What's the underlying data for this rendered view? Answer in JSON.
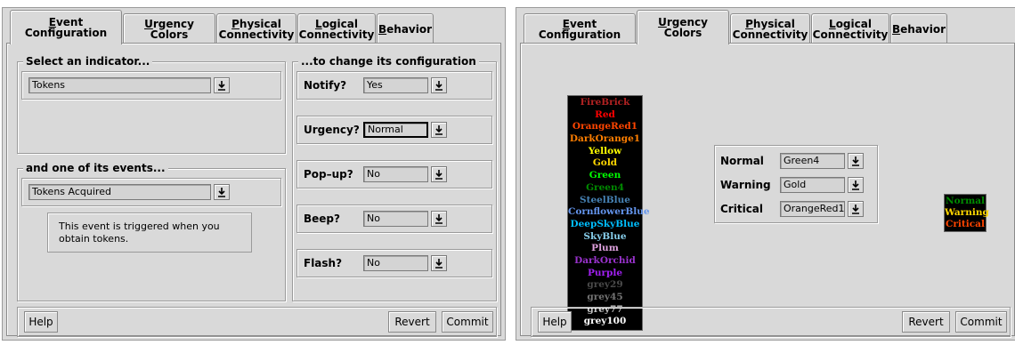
{
  "tabs": [
    {
      "mn": "E",
      "rest": "vent Configuration"
    },
    {
      "mn": "U",
      "rest": "rgency Colors"
    },
    {
      "l1a": "",
      "l1mn": "P",
      "l1b": "hysical",
      "l2": "Connectivity"
    },
    {
      "l1a": "",
      "l1mn": "L",
      "l1b": "ogical",
      "l2": "Connectivity"
    },
    {
      "mn": "B",
      "rest": "ehavior"
    }
  ],
  "event_config": {
    "indicator_title": "Select an indicator...",
    "indicator_value": "Tokens",
    "events_title": "and one of its events...",
    "event_value": "Tokens Acquired",
    "event_description": "This event is triggered when you obtain tokens.",
    "change_title": "...to change its configuration",
    "rows": [
      {
        "label": "Notify?",
        "value": "Yes"
      },
      {
        "label": "Urgency?",
        "value": "Normal"
      },
      {
        "label": "Pop–up?",
        "value": "No"
      },
      {
        "label": "Beep?",
        "value": "No"
      },
      {
        "label": "Flash?",
        "value": "No"
      }
    ]
  },
  "urgency_colors": {
    "palette": [
      {
        "name": "FireBrick",
        "color": "#b22222"
      },
      {
        "name": "Red",
        "color": "#ff0000"
      },
      {
        "name": "OrangeRed1",
        "color": "#ff4500"
      },
      {
        "name": "DarkOrange1",
        "color": "#ff7f00"
      },
      {
        "name": "Yellow",
        "color": "#ffff00"
      },
      {
        "name": "Gold",
        "color": "#ffd700"
      },
      {
        "name": "Green",
        "color": "#00ff00"
      },
      {
        "name": "Green4",
        "color": "#008b00"
      },
      {
        "name": "SteelBlue",
        "color": "#4682b4"
      },
      {
        "name": "CornflowerBlue",
        "color": "#6495ed"
      },
      {
        "name": "DeepSkyBlue",
        "color": "#00bfff"
      },
      {
        "name": "SkyBlue",
        "color": "#87ceeb"
      },
      {
        "name": "Plum",
        "color": "#dda0dd"
      },
      {
        "name": "DarkOrchid",
        "color": "#9932cc"
      },
      {
        "name": "Purple",
        "color": "#a020f0"
      },
      {
        "name": "grey29",
        "color": "#4a4a4a"
      },
      {
        "name": "grey45",
        "color": "#737373"
      },
      {
        "name": "grey77",
        "color": "#c4c4c4"
      },
      {
        "name": "grey100",
        "color": "#ffffff"
      }
    ],
    "levels": [
      {
        "label": "Normal",
        "value": "Green4",
        "color": "#008b00"
      },
      {
        "label": "Warning",
        "value": "Gold",
        "color": "#ffd700"
      },
      {
        "label": "Critical",
        "value": "OrangeRed1",
        "color": "#ff4500"
      }
    ]
  },
  "buttons": {
    "help": "Help",
    "revert": "Revert",
    "commit": "Commit"
  }
}
